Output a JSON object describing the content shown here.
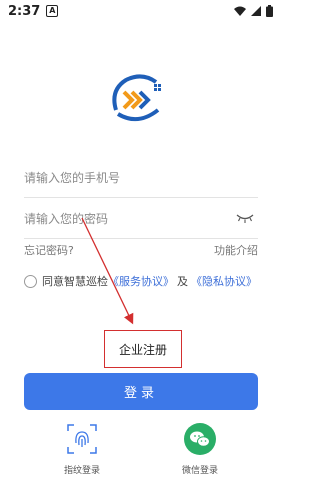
{
  "status_bar": {
    "time": "2:37",
    "notif_letter": "A"
  },
  "phone_field": {
    "placeholder": "请输入您的手机号"
  },
  "password_field": {
    "placeholder": "请输入您的密码"
  },
  "links": {
    "forgot": "忘记密码?",
    "features": "功能介绍"
  },
  "agreement": {
    "prefix": "同意智慧巡检",
    "service": "《服务协议》",
    "and": "及",
    "privacy": "《隐私协议》"
  },
  "register_label": "企业注册",
  "login_label": "登录",
  "alt_logins": [
    {
      "label": "指纹登录",
      "icon": "fingerprint-icon"
    },
    {
      "label": "微信登录",
      "icon": "wechat-icon"
    }
  ],
  "colors": {
    "primary": "#3d78e8",
    "highlight": "#d32f2f",
    "wechat": "#2aae67"
  }
}
